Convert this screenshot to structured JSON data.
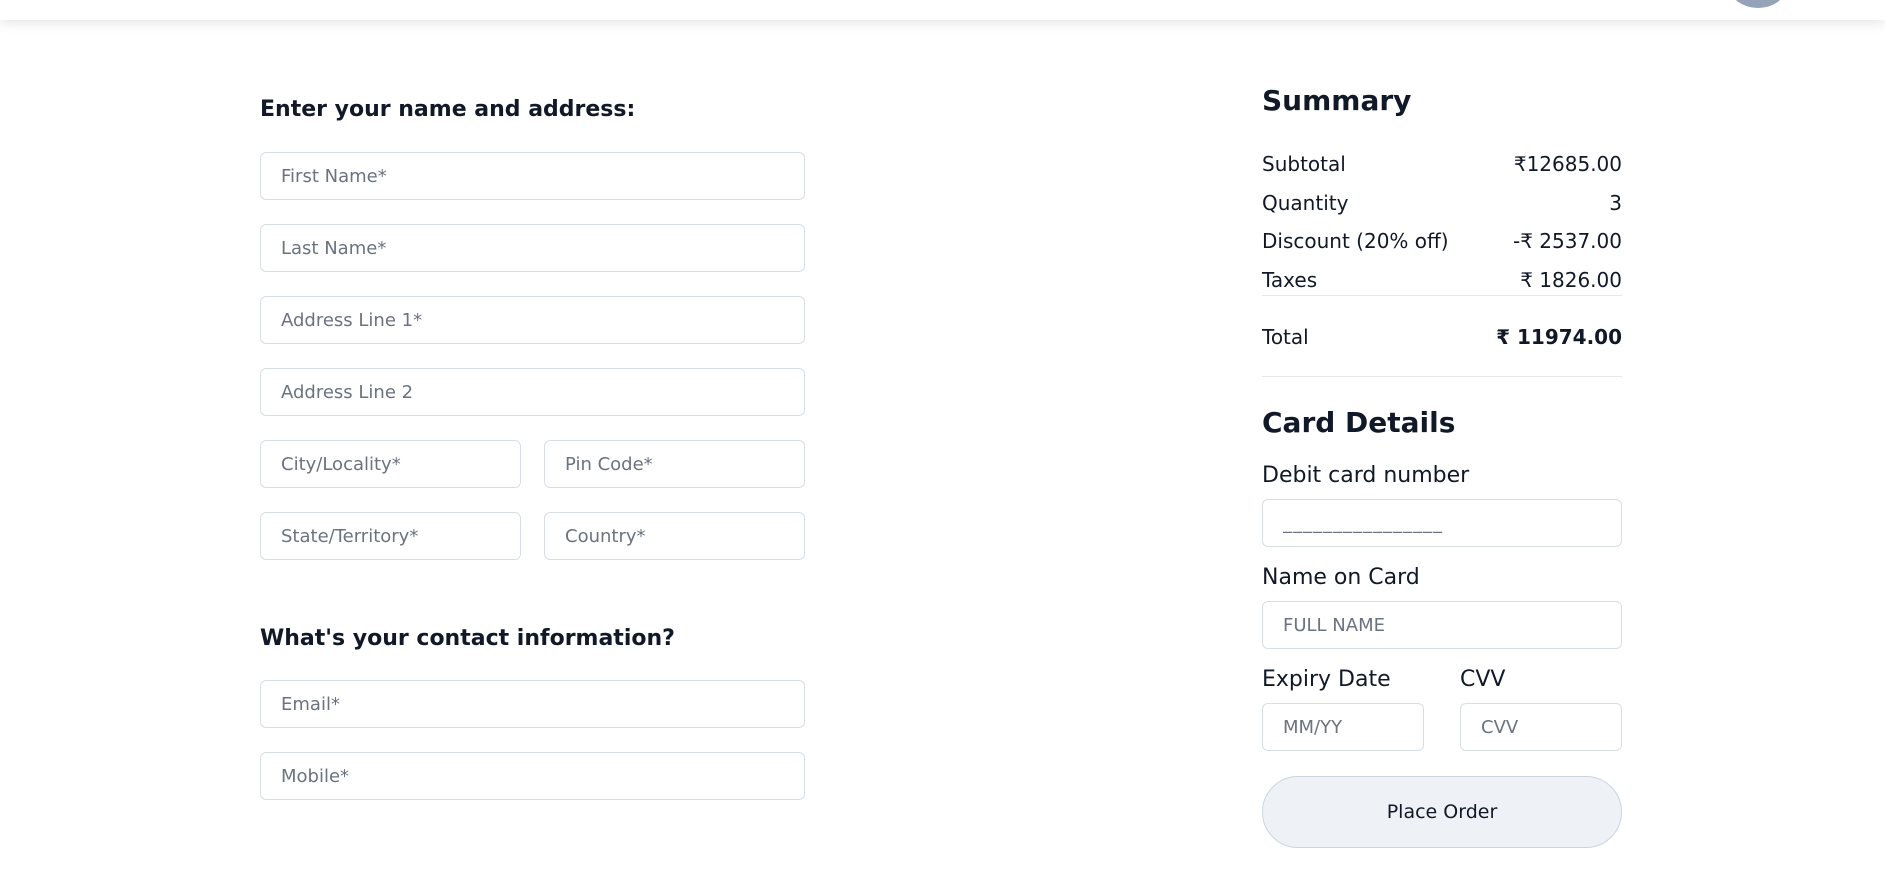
{
  "address_section": {
    "title": "Enter your name and address:",
    "first_name_placeholder": "First Name*",
    "last_name_placeholder": "Last Name*",
    "address1_placeholder": "Address Line 1*",
    "address2_placeholder": "Address Line 2",
    "city_placeholder": "City/Locality*",
    "pin_placeholder": "Pin Code*",
    "state_placeholder": "State/Territory*",
    "country_placeholder": "Country*"
  },
  "contact_section": {
    "title": "What's your contact information?",
    "email_placeholder": "Email*",
    "mobile_placeholder": "Mobile*"
  },
  "summary": {
    "title": "Summary",
    "rows": [
      {
        "label": "Subtotal",
        "value": "₹12685.00"
      },
      {
        "label": "Quantity",
        "value": "3"
      },
      {
        "label": "Discount (20% off)",
        "value": "-₹ 2537.00"
      },
      {
        "label": "Taxes",
        "value": "₹ 1826.00"
      }
    ],
    "total_label": "Total",
    "total_value": "₹ 11974.00"
  },
  "card": {
    "title": "Card Details",
    "number_label": "Debit card number",
    "number_placeholder": "________________",
    "name_label": "Name on Card",
    "name_placeholder": "FULL NAME",
    "expiry_label": "Expiry Date",
    "expiry_placeholder": "MM/YY",
    "cvv_label": "CVV",
    "cvv_placeholder": "CVV"
  },
  "actions": {
    "place_order_label": "Place Order"
  },
  "colors": {
    "button_background": "#eef2f6",
    "input_border": "#d8dee6",
    "avatar": "#94a3b8"
  }
}
